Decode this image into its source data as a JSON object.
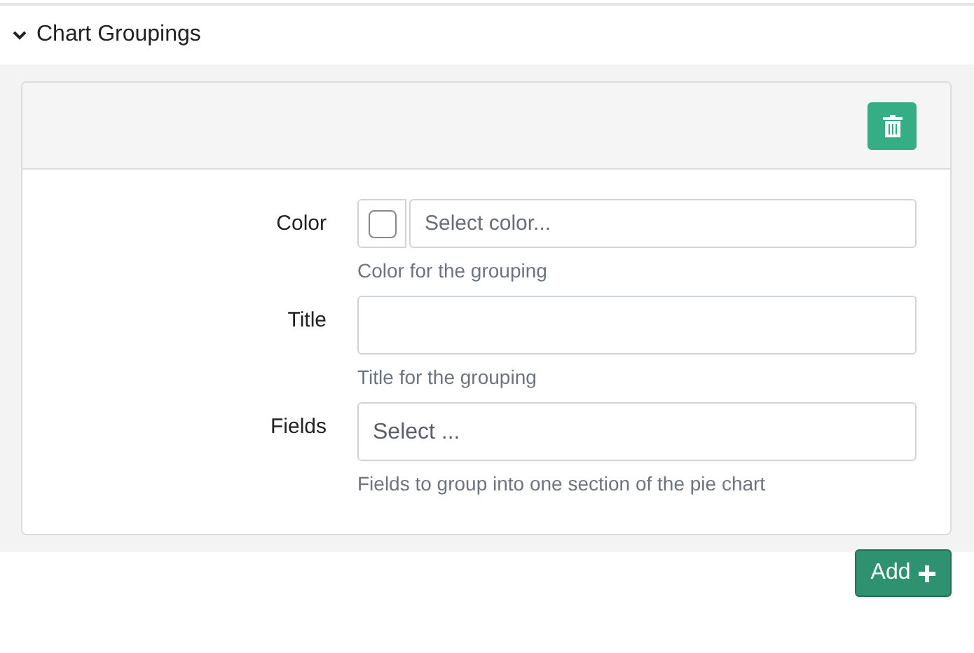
{
  "section": {
    "title": "Chart Groupings",
    "expanded": true
  },
  "grouping": {
    "fields": [
      {
        "kind": "color",
        "label": "Color",
        "placeholder": "Select color...",
        "help": "Color for the grouping"
      },
      {
        "kind": "text",
        "label": "Title",
        "help": "Title for the grouping"
      },
      {
        "kind": "select",
        "label": "Fields",
        "placeholder": "Select ...",
        "help": "Fields to group into one section of the pie chart"
      }
    ]
  },
  "add_button": {
    "label": "Add"
  }
}
